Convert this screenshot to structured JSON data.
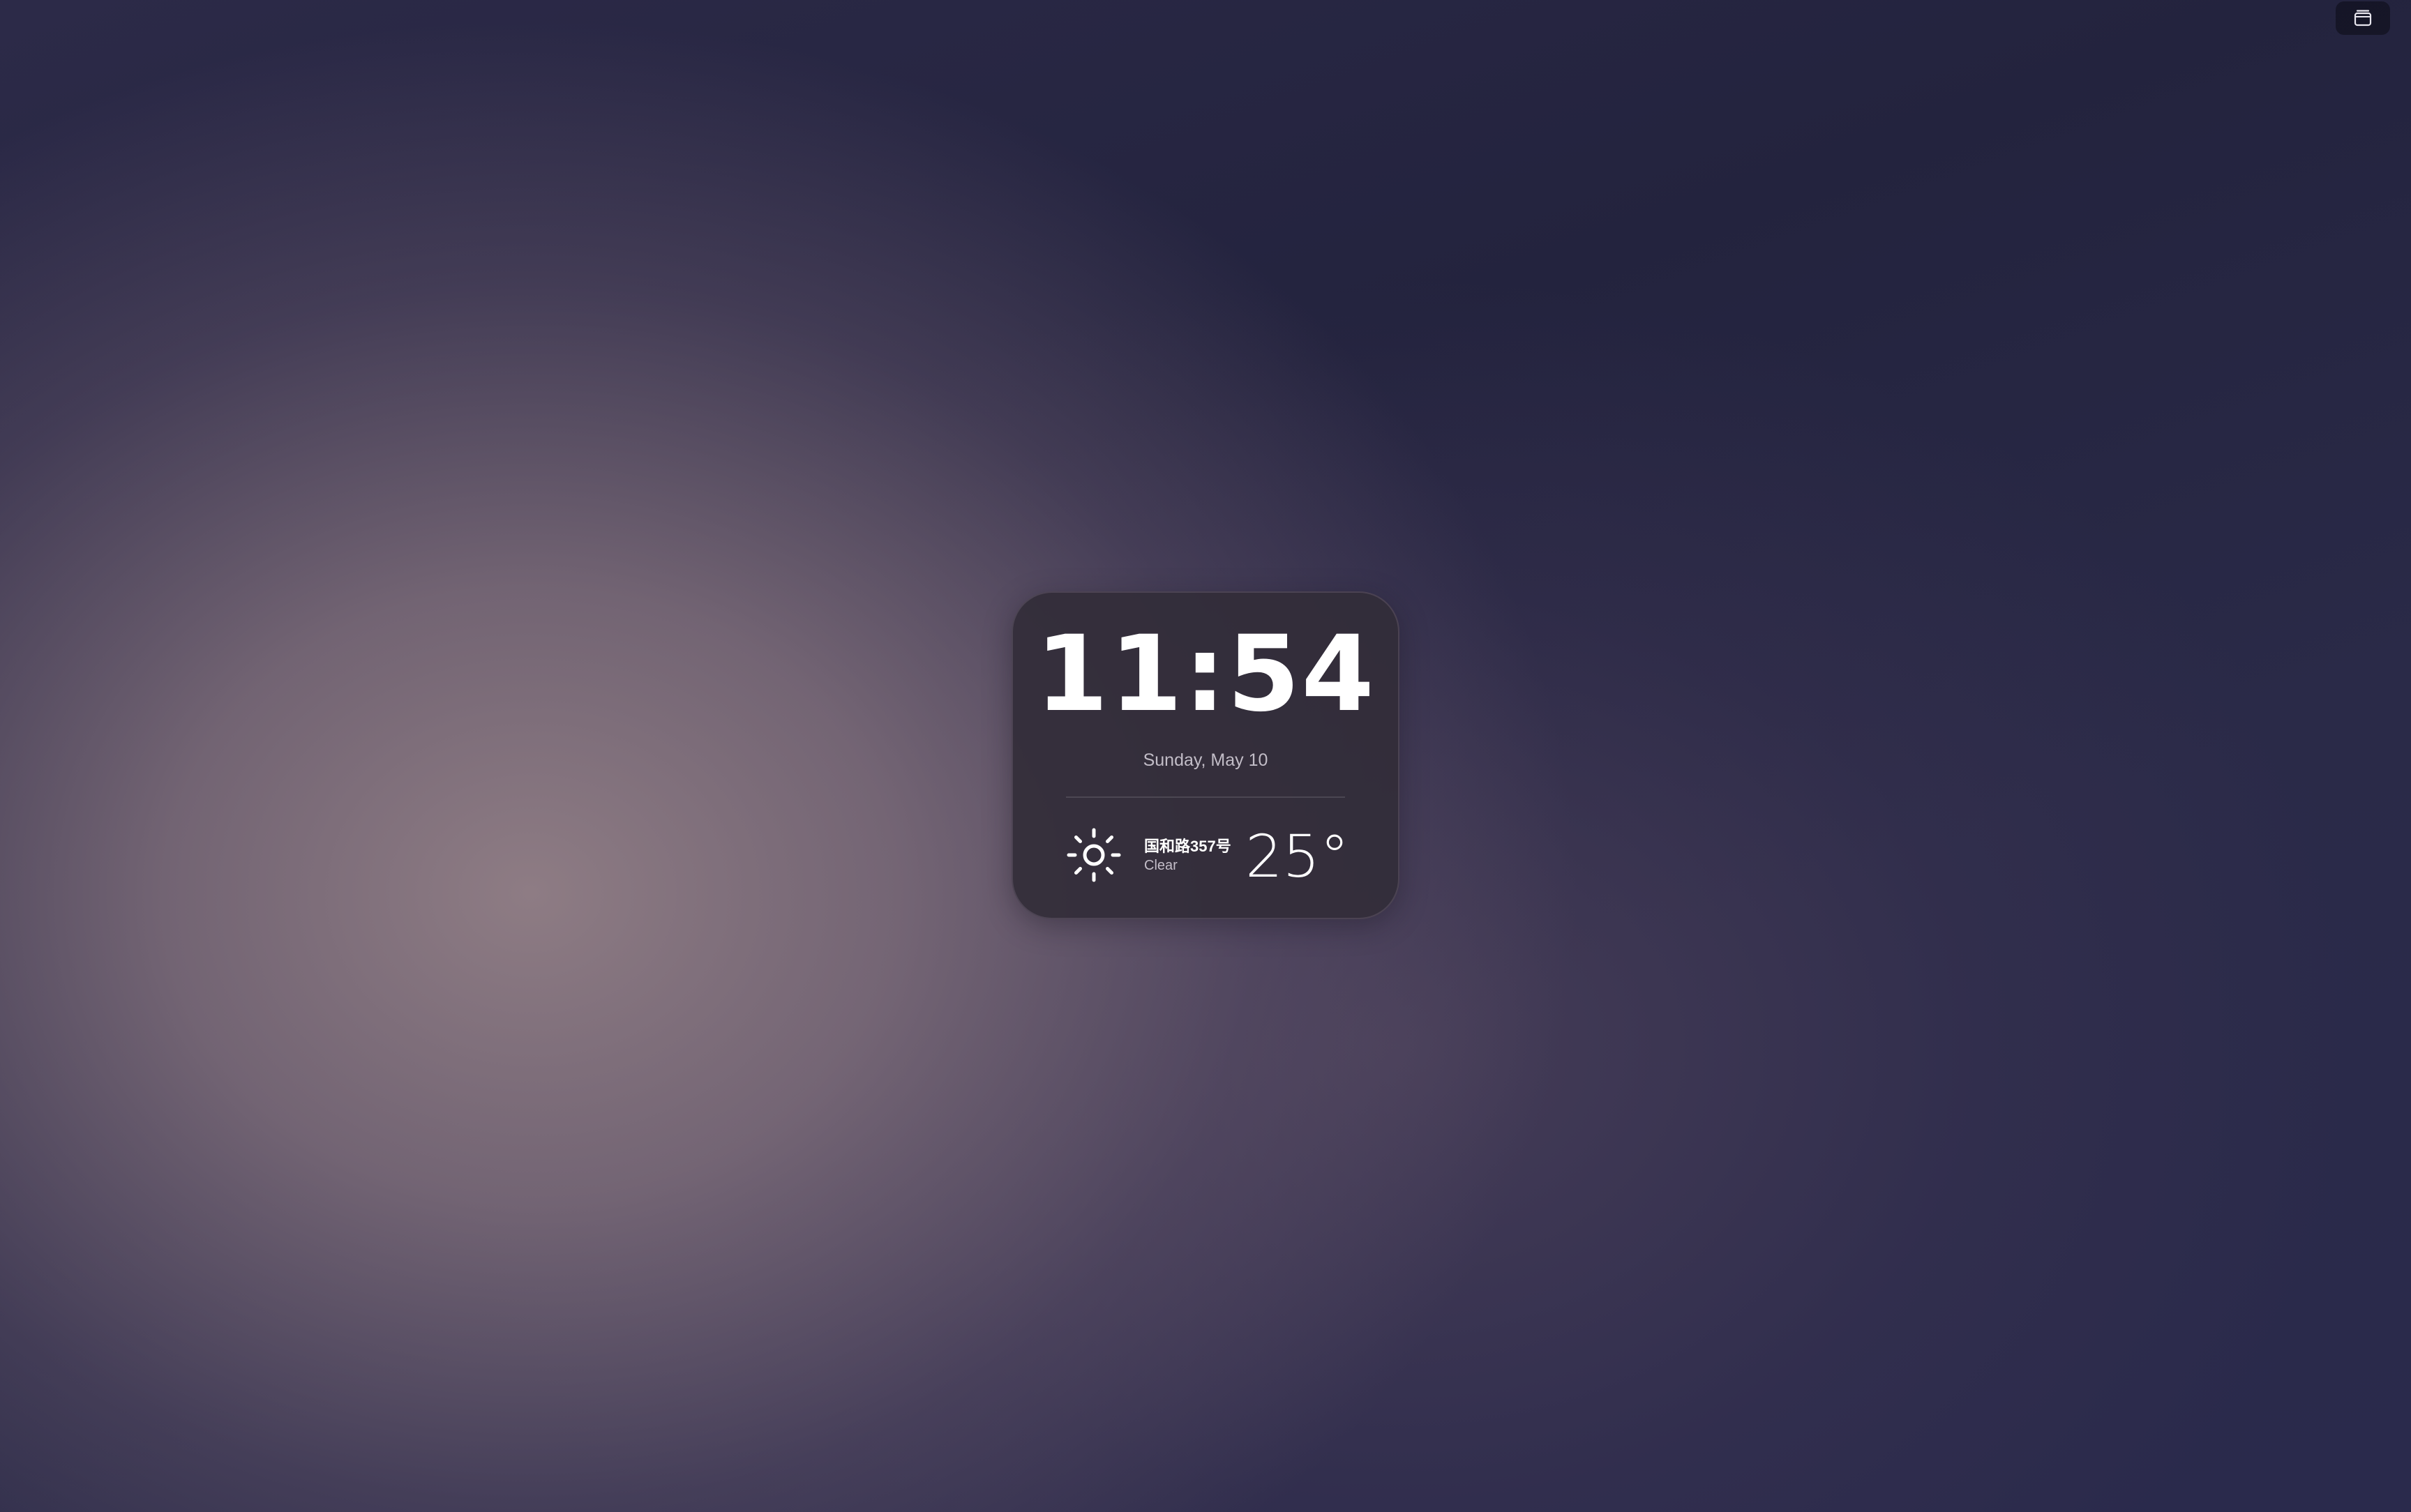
{
  "corner_widget": {
    "icon": "window-stack-icon"
  },
  "clock": {
    "time": "11:54",
    "date": "Sunday, May 10"
  },
  "weather": {
    "icon": "sun-icon",
    "location": "国和路357号",
    "condition": "Clear",
    "temperature": "25°"
  },
  "colors": {
    "card_background": "#322c38",
    "text_primary": "#ffffff",
    "text_secondary": "#dcd6e0"
  }
}
